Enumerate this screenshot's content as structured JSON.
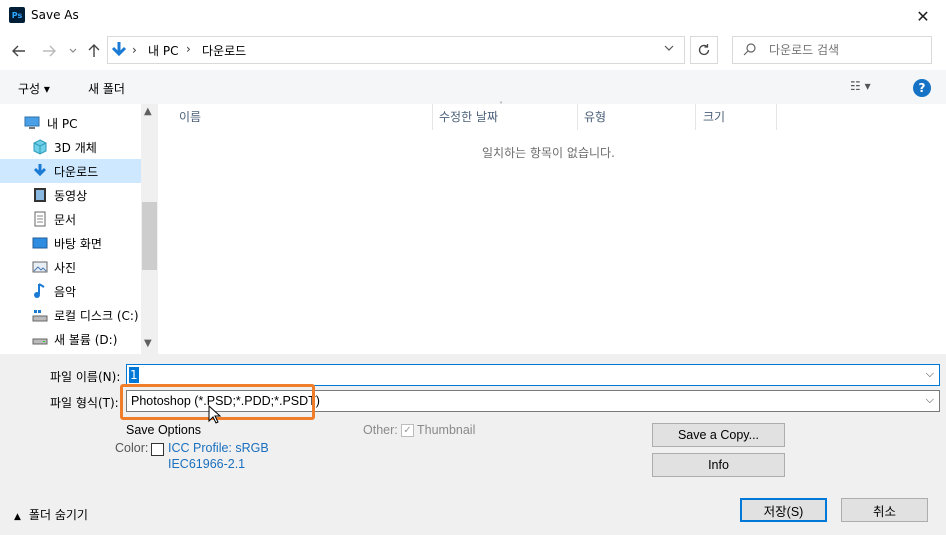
{
  "window": {
    "app_icon_text": "Ps",
    "title": "Save As",
    "close_glyph": "✕"
  },
  "address": {
    "root": "내 PC",
    "separator": "›",
    "current": "다운로드",
    "search_placeholder": "다운로드 검색"
  },
  "toolbar": {
    "organize_label": "구성 ▾",
    "new_folder_label": "새 폴더",
    "view_glyph": "☷ ▾",
    "help_glyph": "?"
  },
  "nav": {
    "items": [
      {
        "label": "내 PC",
        "icon": "computer-icon"
      },
      {
        "label": "3D 개체",
        "icon": "cube-icon"
      },
      {
        "label": "다운로드",
        "icon": "download-icon",
        "selected": true
      },
      {
        "label": "동영상",
        "icon": "film-icon"
      },
      {
        "label": "문서",
        "icon": "document-icon"
      },
      {
        "label": "바탕 화면",
        "icon": "desktop-icon"
      },
      {
        "label": "사진",
        "icon": "picture-icon"
      },
      {
        "label": "음악",
        "icon": "music-icon"
      },
      {
        "label": "로컬 디스크 (C:)",
        "icon": "drive-icon"
      },
      {
        "label": "새 볼륨 (D:)",
        "icon": "drive-icon"
      }
    ]
  },
  "filelist": {
    "columns": [
      "이름",
      "수정한 날짜",
      "유형",
      "크기"
    ],
    "empty_message": "일치하는 항목이 없습니다."
  },
  "form": {
    "filename_label": "파일 이름(N):",
    "filename_value": "1",
    "filetype_label": "파일 형식(T):",
    "filetype_value": "Photoshop (*.PSD;*.PDD;*.PSDT)",
    "save_options_label": "Save Options",
    "color_label": "Color:",
    "icc_line1": "ICC Profile:  sRGB",
    "icc_line2": "IEC61966-2.1",
    "other_label": "Other:",
    "thumbnail_label": "Thumbnail",
    "thumbnail_checked": true,
    "icc_checked": false
  },
  "buttons": {
    "save_a_copy": "Save a Copy...",
    "info": "Info",
    "save": "저장(S)",
    "cancel": "취소",
    "hide_folders": "폴더 숨기기"
  },
  "colors": {
    "accent": "#0078d7",
    "highlight": "#f07d29",
    "selected_bg": "#cde8ff"
  }
}
